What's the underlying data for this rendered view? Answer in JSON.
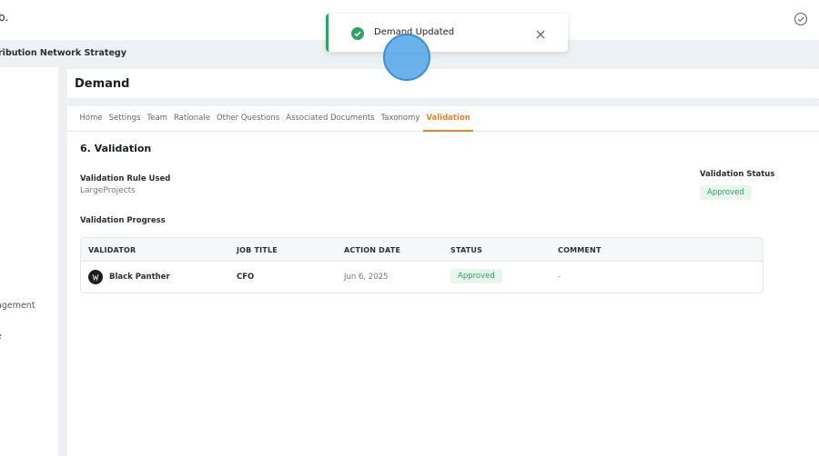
{
  "topbar": {
    "brand_fragment": "b."
  },
  "breadcrumb": {
    "text": "ribution Network Strategy"
  },
  "sidebar": {
    "items": [
      "agement",
      "e"
    ]
  },
  "header": {
    "title": "Demand"
  },
  "tabs": [
    {
      "label": "Home",
      "active": false
    },
    {
      "label": "Settings",
      "active": false
    },
    {
      "label": "Team",
      "active": false
    },
    {
      "label": "Rationale",
      "active": false
    },
    {
      "label": "Other Questions",
      "active": false
    },
    {
      "label": "Associated Documents",
      "active": false
    },
    {
      "label": "Taxonomy",
      "active": false
    },
    {
      "label": "Validation",
      "active": true
    }
  ],
  "section": {
    "title": "6. Validation",
    "rule_label": "Validation Rule Used",
    "rule_value": "LargeProjects",
    "status_label": "Validation Status",
    "status_value": "Approved",
    "progress_label": "Validation Progress"
  },
  "table": {
    "headers": [
      "VALIDATOR",
      "JOB TITLE",
      "ACTION DATE",
      "STATUS",
      "COMMENT"
    ],
    "rows": [
      {
        "validator": "Black Panther",
        "job_title": "CFO",
        "action_date": "Jun 6, 2025",
        "status": "Approved",
        "comment": "-"
      }
    ]
  },
  "toast": {
    "message": "Demand Updated"
  },
  "colors": {
    "accent": "#e3862a",
    "success": "#2fa365",
    "success_bg": "#e8f6ee"
  }
}
